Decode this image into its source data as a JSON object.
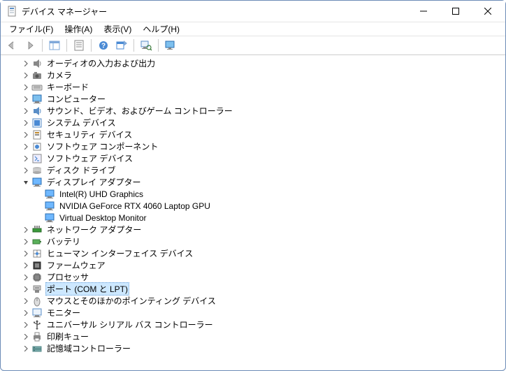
{
  "window": {
    "title": "デバイス マネージャー"
  },
  "menu": {
    "file": "ファイル(F)",
    "action": "操作(A)",
    "view": "表示(V)",
    "help": "ヘルプ(H)"
  },
  "tree": [
    {
      "label": "オーディオの入力および出力",
      "icon": "speaker",
      "expanded": false,
      "indent": 1,
      "selected": false
    },
    {
      "label": "カメラ",
      "icon": "camera",
      "expanded": false,
      "indent": 1,
      "selected": false
    },
    {
      "label": "キーボード",
      "icon": "keyboard",
      "expanded": false,
      "indent": 1,
      "selected": false
    },
    {
      "label": "コンピューター",
      "icon": "computer",
      "expanded": false,
      "indent": 1,
      "selected": false
    },
    {
      "label": "サウンド、ビデオ、およびゲーム コントローラー",
      "icon": "sound",
      "expanded": false,
      "indent": 1,
      "selected": false
    },
    {
      "label": "システム デバイス",
      "icon": "system",
      "expanded": false,
      "indent": 1,
      "selected": false
    },
    {
      "label": "セキュリティ デバイス",
      "icon": "security",
      "expanded": false,
      "indent": 1,
      "selected": false
    },
    {
      "label": "ソフトウェア コンポーネント",
      "icon": "swcomp",
      "expanded": false,
      "indent": 1,
      "selected": false
    },
    {
      "label": "ソフトウェア デバイス",
      "icon": "swdev",
      "expanded": false,
      "indent": 1,
      "selected": false
    },
    {
      "label": "ディスク ドライブ",
      "icon": "disk",
      "expanded": false,
      "indent": 1,
      "selected": false
    },
    {
      "label": "ディスプレイ アダプター",
      "icon": "display",
      "expanded": true,
      "indent": 1,
      "selected": false
    },
    {
      "label": "Intel(R) UHD Graphics",
      "icon": "display",
      "expanded": null,
      "indent": 2,
      "selected": false
    },
    {
      "label": "NVIDIA GeForce RTX 4060 Laptop GPU",
      "icon": "display",
      "expanded": null,
      "indent": 2,
      "selected": false
    },
    {
      "label": "Virtual Desktop Monitor",
      "icon": "display",
      "expanded": null,
      "indent": 2,
      "selected": false
    },
    {
      "label": "ネットワーク アダプター",
      "icon": "network",
      "expanded": false,
      "indent": 1,
      "selected": false
    },
    {
      "label": "バッテリ",
      "icon": "battery",
      "expanded": false,
      "indent": 1,
      "selected": false
    },
    {
      "label": "ヒューマン インターフェイス デバイス",
      "icon": "hid",
      "expanded": false,
      "indent": 1,
      "selected": false
    },
    {
      "label": "ファームウェア",
      "icon": "firmware",
      "expanded": false,
      "indent": 1,
      "selected": false
    },
    {
      "label": "プロセッサ",
      "icon": "cpu",
      "expanded": false,
      "indent": 1,
      "selected": false
    },
    {
      "label": "ポート (COM と LPT)",
      "icon": "port",
      "expanded": false,
      "indent": 1,
      "selected": true
    },
    {
      "label": "マウスとそのほかのポインティング デバイス",
      "icon": "mouse",
      "expanded": false,
      "indent": 1,
      "selected": false
    },
    {
      "label": "モニター",
      "icon": "monitor",
      "expanded": false,
      "indent": 1,
      "selected": false
    },
    {
      "label": "ユニバーサル シリアル バス コントローラー",
      "icon": "usb",
      "expanded": false,
      "indent": 1,
      "selected": false
    },
    {
      "label": "印刷キュー",
      "icon": "printer",
      "expanded": false,
      "indent": 1,
      "selected": false
    },
    {
      "label": "記憶域コントローラー",
      "icon": "storage",
      "expanded": false,
      "indent": 1,
      "selected": false
    }
  ]
}
